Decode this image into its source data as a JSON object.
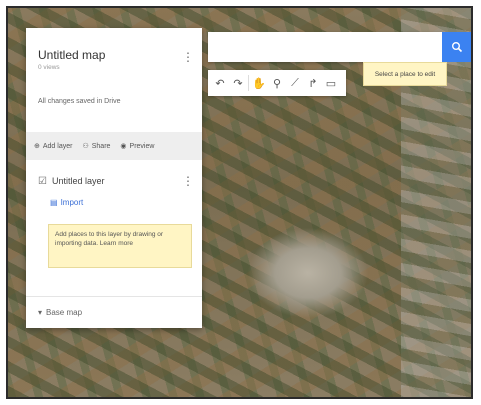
{
  "panel": {
    "title": "Untitled map",
    "subtitle": "0 views",
    "views_text": "All changes saved in Drive",
    "actions": [
      {
        "label": "Add layer",
        "icon": "add-layer-icon"
      },
      {
        "label": "Share",
        "icon": "share-icon"
      },
      {
        "label": "Preview",
        "icon": "preview-icon"
      }
    ],
    "layer": {
      "name": "Untitled layer",
      "import_label": "Import",
      "hint": "Add places to this layer by drawing or importing data. Learn more"
    },
    "basemap_label": "Base map"
  },
  "search": {
    "value": "",
    "icon": "search-icon"
  },
  "toolbar": {
    "tools": [
      "undo-icon",
      "redo-icon",
      "hand-icon",
      "marker-icon",
      "line-icon",
      "route-icon",
      "ruler-icon"
    ]
  },
  "tooltip": {
    "text": "Select a place to edit"
  },
  "colors": {
    "accent": "#3b82f1",
    "hint_bg": "#fff5c4"
  }
}
